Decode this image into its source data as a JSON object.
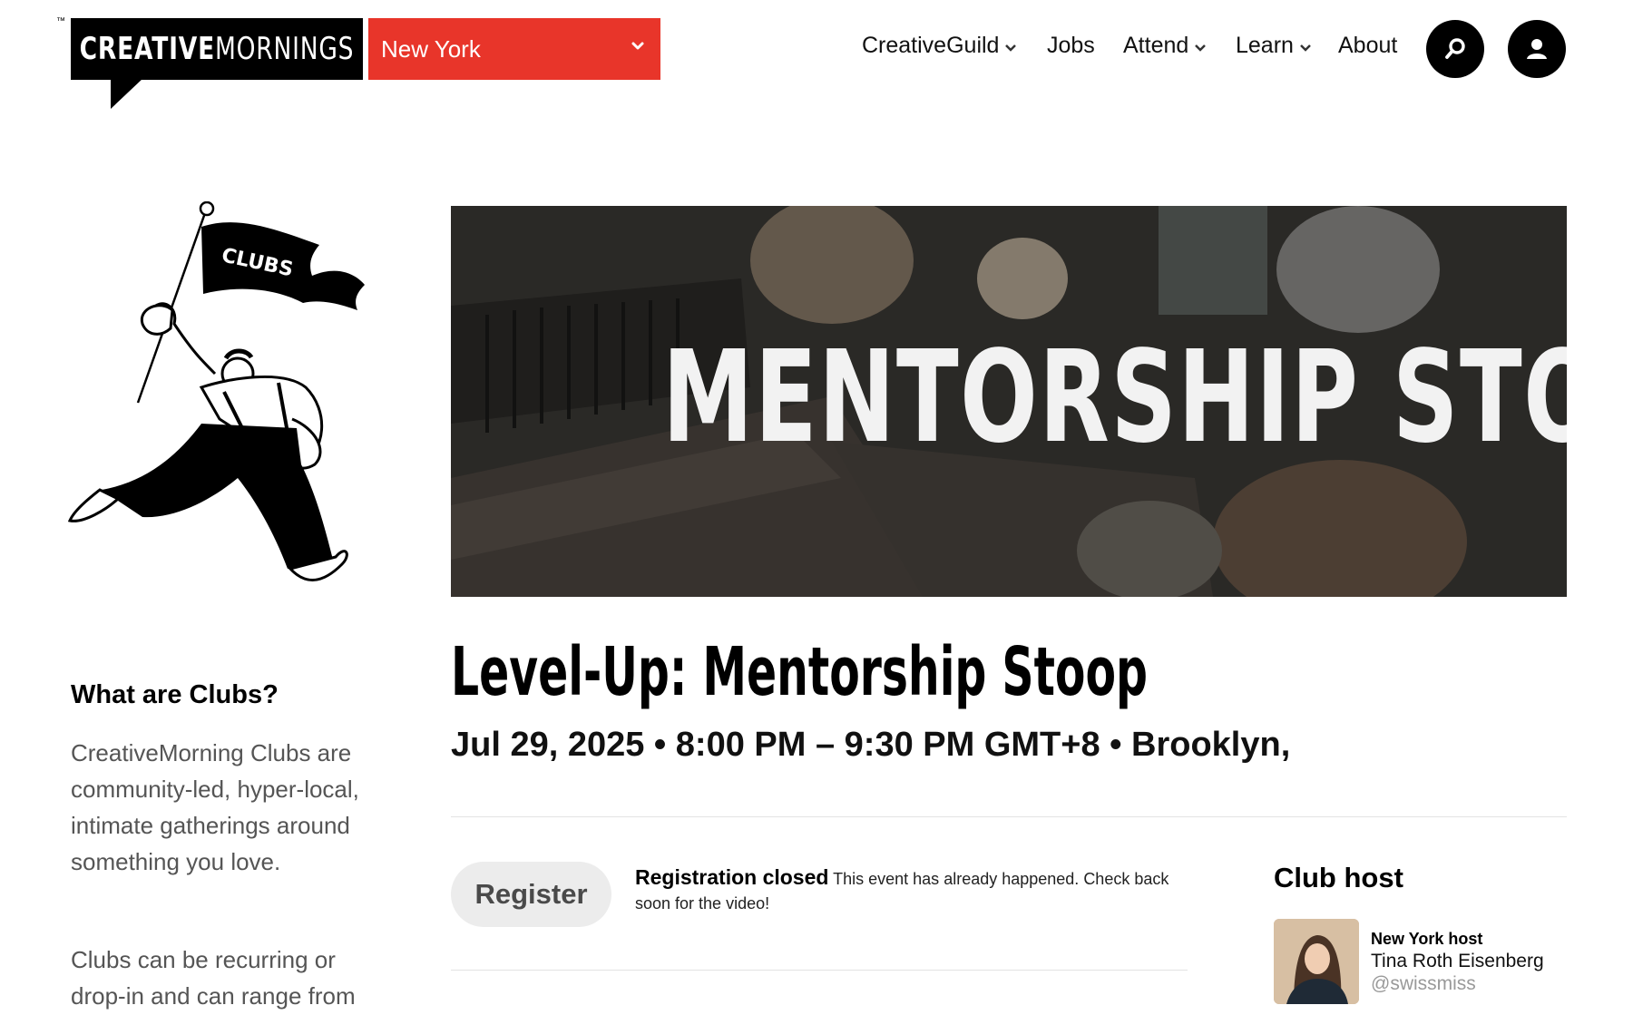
{
  "header": {
    "logo_bold": "CREATIVE",
    "logo_light": "MORNINGS",
    "logo_tm": "™",
    "city": "New York",
    "nav": [
      "CreativeGuild",
      "Jobs",
      "Attend",
      "Learn",
      "About"
    ]
  },
  "sidebar": {
    "illustration_flag_text": "CLUBS",
    "heading": "What are Clubs?",
    "para1": "CreativeMorning Clubs are community-led, hyper-local, intimate gatherings around something you love.",
    "para2": "Clubs can be recurring or drop-in and can range from"
  },
  "event": {
    "hero_text": "MENTORSHIP STOOP",
    "title": "Level-Up: Mentorship Stoop",
    "meta": "Jul 29, 2025 • 8:00 PM – 9:30 PM GMT+8 • Brooklyn,",
    "register_label": "Register",
    "registration_status": "Registration closed",
    "registration_note": "This event has already happened. Check back soon for the video!"
  },
  "host": {
    "heading": "Club host",
    "role": "New York host",
    "name": "Tina Roth Eisenberg",
    "handle": "@swissmiss"
  },
  "colors": {
    "brand_black": "#000000",
    "city_red": "#e8352a",
    "muted_text": "#555555"
  }
}
